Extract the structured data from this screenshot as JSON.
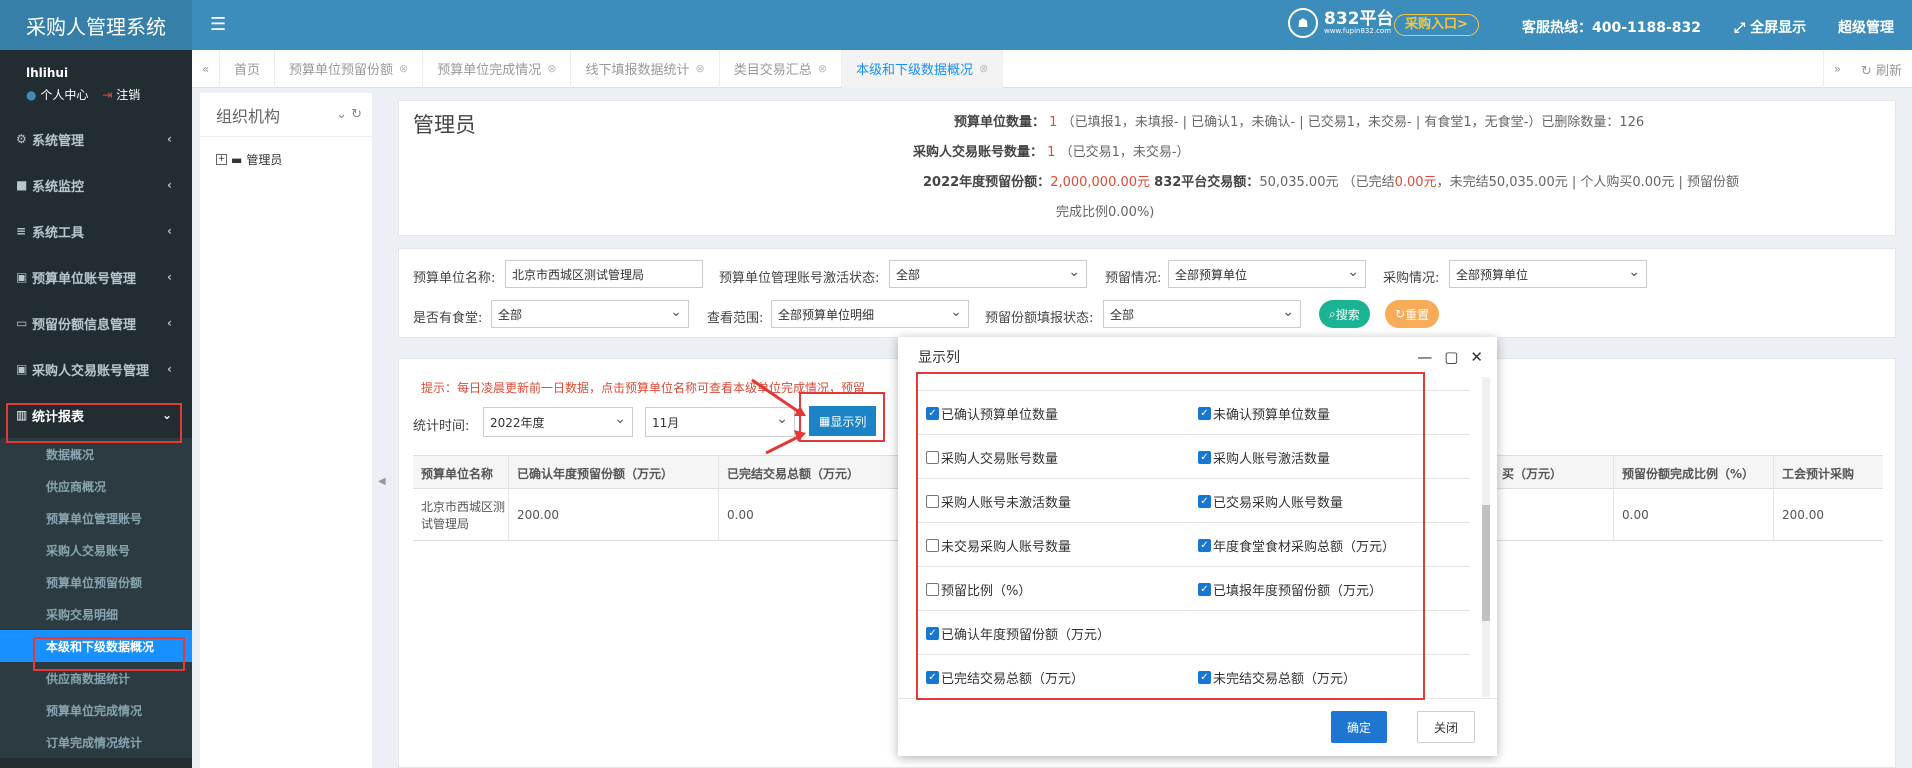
{
  "app": {
    "title": "采购人管理系统"
  },
  "topbar": {
    "logo_big": "832平台",
    "logo_small": "www.fupin832.com",
    "enter_label": "采购入口>",
    "hotline": "客服热线：400-1188-832",
    "fullscreen": "全屏显示",
    "user": "超级管理"
  },
  "user_panel": {
    "name": "lhlihui",
    "center": "个人中心",
    "logout": "注销"
  },
  "sidebar": {
    "items": [
      {
        "label": "系统管理",
        "icon": "gear-icon"
      },
      {
        "label": "系统监控",
        "icon": "video-icon"
      },
      {
        "label": "系统工具",
        "icon": "bars-icon"
      },
      {
        "label": "预算单位账号管理",
        "icon": "id-card-icon"
      },
      {
        "label": "预留份额信息管理",
        "icon": "card-icon"
      },
      {
        "label": "采购人交易账号管理",
        "icon": "id-badge-icon"
      },
      {
        "label": "统计报表",
        "icon": "bar-chart-icon"
      }
    ],
    "subitems": [
      "数据概况",
      "供应商概况",
      "预算单位管理账号",
      "采购人交易账号",
      "预算单位预留份额",
      "采购交易明细",
      "本级和下级数据概况",
      "供应商数据统计",
      "预算单位完成情况",
      "订单完成情况统计"
    ]
  },
  "tabs": {
    "items": [
      {
        "label": "首页"
      },
      {
        "label": "预算单位预留份额"
      },
      {
        "label": "预算单位完成情况"
      },
      {
        "label": "线下填报数据统计"
      },
      {
        "label": "类目交易汇总"
      },
      {
        "label": "本级和下级数据概况"
      }
    ],
    "refresh": "刷新"
  },
  "org": {
    "title": "组织机构",
    "node": "管理员"
  },
  "summary": {
    "title": "管理员",
    "l1": "预算单位数量：",
    "v1": "1",
    "t1": "（已填报1，未填报- | 已确认1，未确认- | 已交易1，未交易- | 有食堂1，无食堂-）已删除数量：126",
    "l2": "采购人交易账号数量：",
    "v2": "1",
    "t2": "（已交易1，未交易-）",
    "l3": "2022年度预留份额：",
    "v3": "2,000,000.00元",
    "l4": "832平台交易额：",
    "t4a": "50,035.00元 （已完结",
    "v4": "0.00元",
    "t4b": "，未完结50,035.00元 | 个人购买0.00元 | 预留份额",
    "t5": "完成比例0.00%)"
  },
  "filter": {
    "unit_name_label": "预算单位名称:",
    "unit_name_value": "北京市西城区测试管理局",
    "activation_label": "预算单位管理账号激活状态:",
    "activation_value": "全部",
    "reserve_label": "预留情况:",
    "reserve_value": "全部预算单位",
    "purchase_label": "采购情况:",
    "purchase_value": "全部预算单位",
    "canteen_label": "是否有食堂:",
    "canteen_value": "全部",
    "scope_label": "查看范围:",
    "scope_value": "全部预算单位明细",
    "report_label": "预留份额填报状态:",
    "report_value": "全部",
    "search": "搜索",
    "reset": "重置"
  },
  "data": {
    "tip": "提示：每日凌晨更新前一日数据，点击预算单位名称可查看本级单位完成情况，预留",
    "time_label": "统计时间:",
    "year": "2022年度",
    "month": "11月",
    "show_cols": "显示列",
    "headers": [
      "预算单位名称",
      "已确认年度预留份额（万元）",
      "已完结交易总额（万元）",
      "买（万元）",
      "预留份额完成比例（%）",
      "工会预计采购"
    ],
    "row": [
      "北京市西城区测试管理局",
      "200.00",
      "0.00",
      "",
      "0.00",
      "200.00"
    ]
  },
  "modal": {
    "title": "显示列",
    "rows": [
      {
        "left": {
          "label": "已确认预算单位数量",
          "checked": true
        },
        "right": {
          "label": "未确认预算单位数量",
          "checked": true
        }
      },
      {
        "left": {
          "label": "采购人交易账号数量",
          "checked": false
        },
        "right": {
          "label": "采购人账号激活数量",
          "checked": true
        }
      },
      {
        "left": {
          "label": "采购人账号未激活数量",
          "checked": false
        },
        "right": {
          "label": "已交易采购人账号数量",
          "checked": true
        }
      },
      {
        "left": {
          "label": "未交易采购人账号数量",
          "checked": false
        },
        "right": {
          "label": "年度食堂食材采购总额（万元）",
          "checked": true
        }
      },
      {
        "left": {
          "label": "预留比例（%）",
          "checked": false
        },
        "right": {
          "label": "已填报年度预留份额（万元）",
          "checked": true
        }
      },
      {
        "left": {
          "label": "已确认年度预留份额（万元）",
          "checked": true
        },
        "right": null
      },
      {
        "left": {
          "label": "已完结交易总额（万元）",
          "checked": true
        },
        "right": {
          "label": "未完结交易总额（万元）",
          "checked": true
        }
      }
    ],
    "ok": "确定",
    "close": "关闭"
  },
  "colors": {
    "accent": "#3c8dbc",
    "sidebar": "#222d32",
    "active": "#1890ff",
    "highlight": "#e53935"
  }
}
